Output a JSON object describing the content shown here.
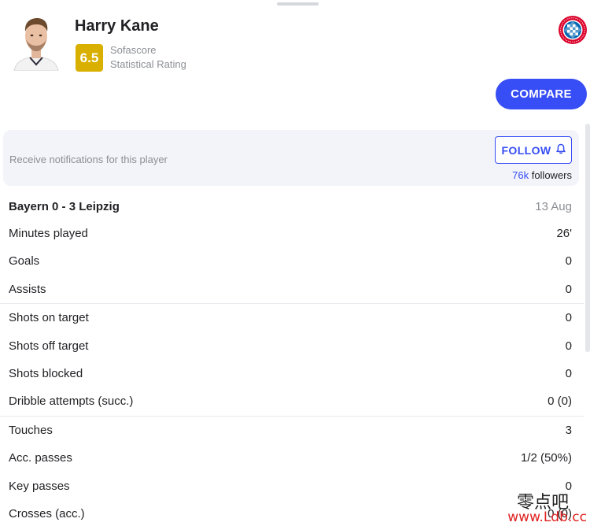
{
  "player": {
    "name": "Harry Kane",
    "rating": "6.5",
    "rating_source": "Sofascore",
    "rating_label": "Statistical Rating",
    "rating_color": "#d9af00",
    "club_logo_icon": "bayern-munich-crest-icon"
  },
  "actions": {
    "compare_label": "COMPARE",
    "follow_label": "FOLLOW",
    "accent_color": "#374df5"
  },
  "notifications": {
    "text": "Receive notifications for this player",
    "followers_count": "76k",
    "followers_label": "followers"
  },
  "match": {
    "title": "Bayern 0 - 3 Leipzig",
    "date": "13 Aug"
  },
  "stat_groups": [
    [
      {
        "label": "Minutes played",
        "value": "26'"
      },
      {
        "label": "Goals",
        "value": "0"
      },
      {
        "label": "Assists",
        "value": "0"
      }
    ],
    [
      {
        "label": "Shots on target",
        "value": "0"
      },
      {
        "label": "Shots off target",
        "value": "0"
      },
      {
        "label": "Shots blocked",
        "value": "0"
      },
      {
        "label": "Dribble attempts (succ.)",
        "value": "0 (0)"
      }
    ],
    [
      {
        "label": "Touches",
        "value": "3"
      },
      {
        "label": "Acc. passes",
        "value": "1/2 (50%)"
      },
      {
        "label": "Key passes",
        "value": "0"
      },
      {
        "label": "Crosses (acc.)",
        "value": "0 (0)"
      }
    ]
  ],
  "watermark": {
    "text_cn": "零点吧",
    "url": "www.Ldb.cc"
  }
}
